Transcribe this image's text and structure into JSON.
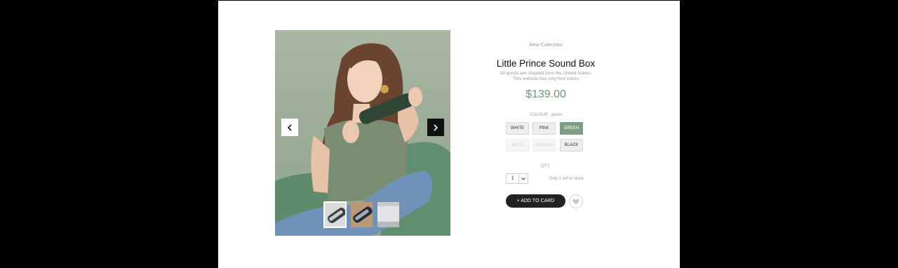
{
  "product": {
    "collection": "New Collection",
    "title": "Little Prince Sound Box",
    "desc_line1": "All goods are shipped from the United States.",
    "desc_line2": "This website has only four colors",
    "price": "$139.00",
    "colour_label": "COLOUR : green",
    "colours": [
      {
        "label": "WHITE",
        "state": "normal"
      },
      {
        "label": "PINK",
        "state": "normal"
      },
      {
        "label": "GREEN",
        "state": "selected"
      },
      {
        "label": "BLUE",
        "state": "disabled"
      },
      {
        "label": "ORANGE",
        "state": "disabled"
      },
      {
        "label": "BLACK",
        "state": "normal"
      }
    ],
    "qty_label": "QTY:",
    "qty_value": "1",
    "stock_text": "Only 1 left in stock",
    "add_label": "+ ADD TO CARD"
  },
  "gallery": {
    "icons": {
      "prev": "chevron-left-icon",
      "next": "chevron-right-icon",
      "wish": "heart-icon"
    },
    "thumbs_count": 3,
    "active_thumb": 1
  },
  "colors": {
    "accent": "#6d9679",
    "selected_swatch": "#7c9c84",
    "button": "#222222",
    "photo_background": "#a0b09a"
  }
}
